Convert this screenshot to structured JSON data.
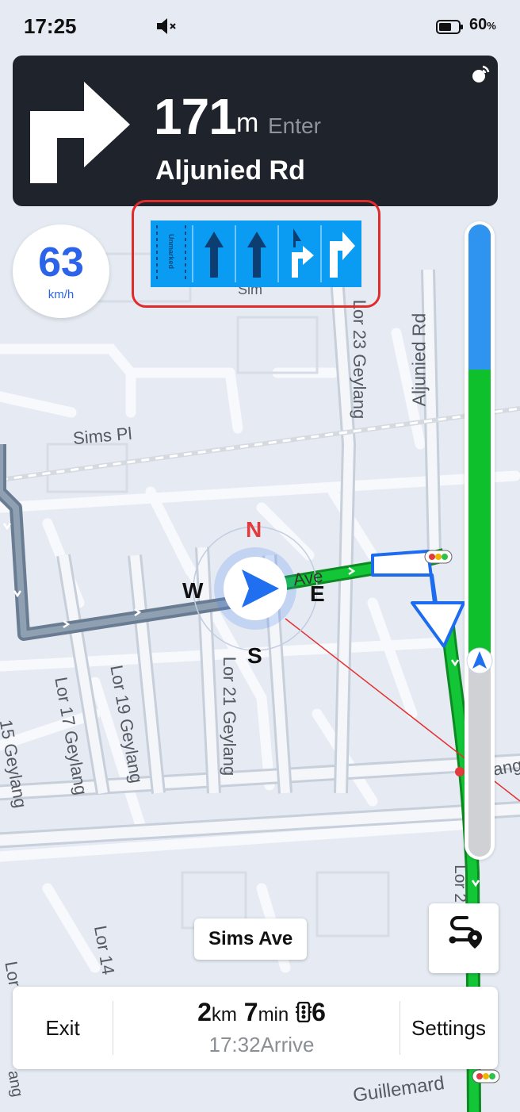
{
  "status_bar": {
    "time": "17:25",
    "battery_pct": "60",
    "battery_unit": "%",
    "icons": [
      "mute-icon",
      "battery-icon"
    ]
  },
  "instruction": {
    "maneuver_icon": "turn-right-icon",
    "distance_value": "171",
    "distance_unit": "m",
    "action": "Enter",
    "road": "Aljunied Rd",
    "corner_icon": "signal-icon"
  },
  "speed": {
    "value": "63",
    "unit": "km/h"
  },
  "lanes": {
    "unmarked_label": "Unmarked",
    "items": [
      {
        "type": "unmarked",
        "recommended": false
      },
      {
        "type": "straight",
        "recommended": false
      },
      {
        "type": "straight",
        "recommended": false
      },
      {
        "type": "straight-right",
        "recommended": true
      },
      {
        "type": "right",
        "recommended": true
      }
    ]
  },
  "progress": {
    "segments": [
      {
        "color": "#2f93f0",
        "from": 0.0,
        "to": 0.23
      },
      {
        "color": "#0ec02b",
        "from": 0.23,
        "to": 0.68
      },
      {
        "color": "#cfd1d4",
        "from": 0.68,
        "to": 1.0
      }
    ],
    "vehicle_position": 0.69
  },
  "map": {
    "labels": {
      "sims_pl": "Sims Pl",
      "aljunied_rd": "Aljunied Rd",
      "lor23": "Lor 23 Geylang",
      "lor21": "Lor 21 Geylang",
      "lor19": "Lor 19 Geylang",
      "lor17": "Lor 17 Geylang",
      "lor15": "15 Geylang",
      "lor14": "Lor 14",
      "lor_left": "Lor",
      "guillemard": "Guillemard",
      "ave_partial": "Ave",
      "ylang": "ylang",
      "lor_right": "Lor 2",
      "sim": "Sim",
      "ang": "ang"
    },
    "compass": {
      "n": "N",
      "s": "S",
      "e": "E",
      "w": "W"
    },
    "colors": {
      "route": "#0ec02b",
      "traveled": "#6a7c91"
    }
  },
  "current_road": "Sims Ave",
  "bottom_bar": {
    "exit": "Exit",
    "settings": "Settings",
    "remaining_distance": "2",
    "distance_unit": "km",
    "remaining_time": "7",
    "time_unit": "min",
    "traffic_lights": "6",
    "arrival_time": "17:32",
    "arrival_label": "Arrive"
  }
}
